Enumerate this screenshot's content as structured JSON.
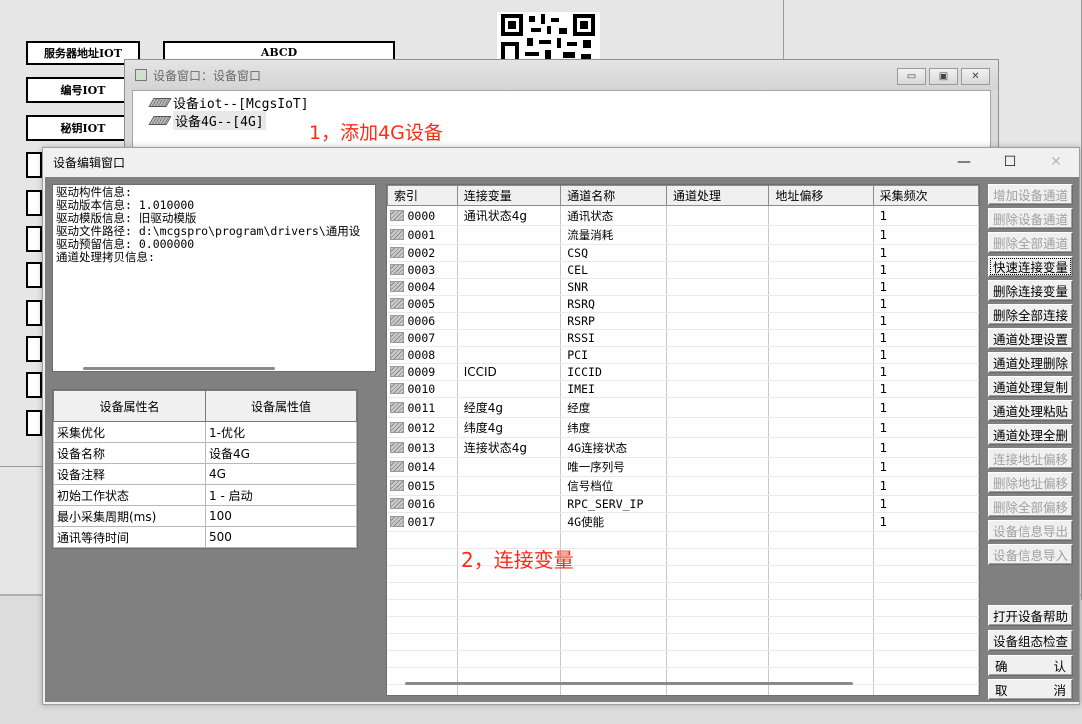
{
  "background": {
    "buttons": [
      "服务器地址IOT",
      "ABCD",
      "编号IOT",
      "秘钥IOT"
    ]
  },
  "device_window": {
    "title": "设备窗口：设备窗口",
    "tree": [
      {
        "label": "设备iot--[McgsIoT]"
      },
      {
        "label": "设备4G--[4G]"
      }
    ],
    "annotation_1": "1，添加4G设备"
  },
  "editor": {
    "title": "设备编辑窗口",
    "info_lines": [
      "驱动构件信息:",
      "驱动版本信息: 1.010000",
      "驱动模版信息: 旧驱动模版",
      "驱动文件路径: d:\\mcgspro\\program\\drivers\\通用设",
      "驱动预留信息: 0.000000",
      "通道处理拷贝信息:"
    ],
    "props": {
      "headers": [
        "设备属性名",
        "设备属性值"
      ],
      "rows": [
        [
          "采集优化",
          "1-优化"
        ],
        [
          "设备名称",
          "设备4G"
        ],
        [
          "设备注释",
          "4G"
        ],
        [
          "初始工作状态",
          "1 - 启动"
        ],
        [
          "最小采集周期(ms)",
          "100"
        ],
        [
          "通讯等待时间",
          "500"
        ]
      ]
    },
    "grid": {
      "headers": [
        "索引",
        "连接变量",
        "通道名称",
        "通道处理",
        "地址偏移",
        "采集频次"
      ],
      "rows": [
        [
          "0000",
          "通讯状态4g",
          "通讯状态",
          "",
          "",
          "1"
        ],
        [
          "0001",
          "",
          "流量消耗",
          "",
          "",
          "1"
        ],
        [
          "0002",
          "",
          "CSQ",
          "",
          "",
          "1"
        ],
        [
          "0003",
          "",
          "CEL",
          "",
          "",
          "1"
        ],
        [
          "0004",
          "",
          "SNR",
          "",
          "",
          "1"
        ],
        [
          "0005",
          "",
          "RSRQ",
          "",
          "",
          "1"
        ],
        [
          "0006",
          "",
          "RSRP",
          "",
          "",
          "1"
        ],
        [
          "0007",
          "",
          "RSSI",
          "",
          "",
          "1"
        ],
        [
          "0008",
          "",
          "PCI",
          "",
          "",
          "1"
        ],
        [
          "0009",
          "ICCID",
          "ICCID",
          "",
          "",
          "1"
        ],
        [
          "0010",
          "",
          "IMEI",
          "",
          "",
          "1"
        ],
        [
          "0011",
          "经度4g",
          "经度",
          "",
          "",
          "1"
        ],
        [
          "0012",
          "纬度4g",
          "纬度",
          "",
          "",
          "1"
        ],
        [
          "0013",
          "连接状态4g",
          "4G连接状态",
          "",
          "",
          "1"
        ],
        [
          "0014",
          "",
          "唯一序列号",
          "",
          "",
          "1"
        ],
        [
          "0015",
          "",
          "信号档位",
          "",
          "",
          "1"
        ],
        [
          "0016",
          "",
          "RPC_SERV_IP",
          "",
          "",
          "1"
        ],
        [
          "0017",
          "",
          "4G使能",
          "",
          "",
          "1"
        ]
      ]
    },
    "annotation_2": "2，连接变量",
    "buttons_top": [
      {
        "label": "增加设备通道",
        "enabled": false
      },
      {
        "label": "删除设备通道",
        "enabled": false
      },
      {
        "label": "删除全部通道",
        "enabled": false
      },
      {
        "label": "快速连接变量",
        "enabled": true
      },
      {
        "label": "删除连接变量",
        "enabled": true
      },
      {
        "label": "删除全部连接",
        "enabled": true
      },
      {
        "label": "通道处理设置",
        "enabled": true
      },
      {
        "label": "通道处理删除",
        "enabled": true
      },
      {
        "label": "通道处理复制",
        "enabled": true
      },
      {
        "label": "通道处理粘贴",
        "enabled": true
      },
      {
        "label": "通道处理全删",
        "enabled": true
      },
      {
        "label": "连接地址偏移",
        "enabled": false
      },
      {
        "label": "删除地址偏移",
        "enabled": false
      },
      {
        "label": "删除全部偏移",
        "enabled": false
      },
      {
        "label": "设备信息导出",
        "enabled": false
      },
      {
        "label": "设备信息导入",
        "enabled": false
      }
    ],
    "buttons_bottom": [
      {
        "label": "打开设备帮助"
      },
      {
        "label": "设备组态检查"
      }
    ],
    "confirm": [
      "确",
      "认"
    ],
    "cancel": [
      "取",
      "消"
    ]
  },
  "colors": {
    "annotation": "#ff2a12"
  }
}
